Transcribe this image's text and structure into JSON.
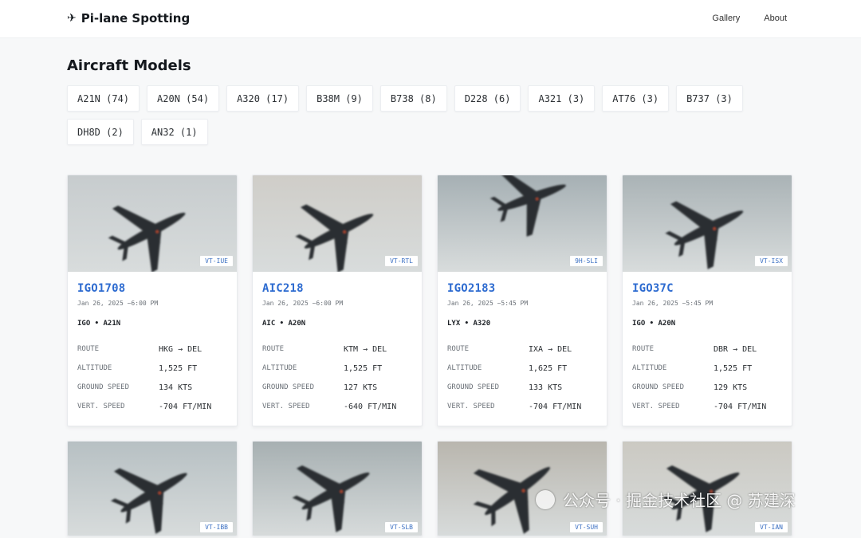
{
  "header": {
    "brand_icon": "✈",
    "brand_title": "Pi-lane Spotting",
    "nav": [
      "Gallery",
      "About"
    ]
  },
  "models": {
    "title": "Aircraft Models",
    "chips": [
      "A21N (74)",
      "A20N (54)",
      "A320 (17)",
      "B38M (9)",
      "B738 (8)",
      "D228 (6)",
      "A321 (3)",
      "AT76 (3)",
      "B737 (3)",
      "DH8D (2)",
      "AN32 (1)"
    ]
  },
  "labels": {
    "route": "ROUTE",
    "altitude": "ALTITUDE",
    "ground_speed": "GROUND SPEED",
    "vert_speed": "VERT. SPEED"
  },
  "cards": [
    {
      "reg": "VT-IUE",
      "callsign": "IGO1708",
      "time": "Jan 26, 2025 ~6:00 PM",
      "operator": "IGO • A21N",
      "route": "HKG → DEL",
      "altitude": "1,525 FT",
      "ground_speed": "134 KTS",
      "vert_speed": "-704 FT/MIN",
      "sky": "#c7ccce"
    },
    {
      "reg": "VT-RTL",
      "callsign": "AIC218",
      "time": "Jan 26, 2025 ~6:00 PM",
      "operator": "AIC • A20N",
      "route": "KTM → DEL",
      "altitude": "1,525 FT",
      "ground_speed": "127 KTS",
      "vert_speed": "-640 FT/MIN",
      "sky": "#cfcdc8"
    },
    {
      "reg": "9H-SLI",
      "callsign": "IGO2183",
      "time": "Jan 26, 2025 ~5:45 PM",
      "operator": "LYX • A320",
      "route": "IXA → DEL",
      "altitude": "1,625 FT",
      "ground_speed": "133 KTS",
      "vert_speed": "-704 FT/MIN",
      "sky": "#a6b0b4"
    },
    {
      "reg": "VT-ISX",
      "callsign": "IGO37C",
      "time": "Jan 26, 2025 ~5:45 PM",
      "operator": "IGO • A20N",
      "route": "DBR → DEL",
      "altitude": "1,525 FT",
      "ground_speed": "129 KTS",
      "vert_speed": "-704 FT/MIN",
      "sky": "#aab3b6"
    },
    {
      "reg": "VT-IBB",
      "sky": "#b7c0c3"
    },
    {
      "reg": "VT-SLB",
      "sky": "#a7b0b2"
    },
    {
      "reg": "VT-SUH",
      "sky": "#b9b6ae"
    },
    {
      "reg": "VT-IAN",
      "sky": "#cbc9c2"
    }
  ],
  "watermark": "公众号 · 掘金技术社区 @ 苏建深",
  "icons": {
    "brand": "airplane-icon"
  }
}
